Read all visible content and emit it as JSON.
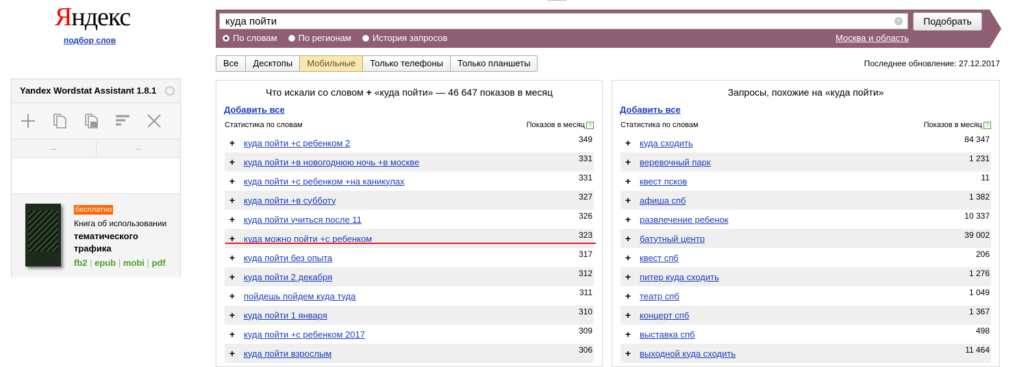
{
  "logo": {
    "text_first": "Я",
    "text_rest": "ндекс",
    "subtitle": "подбор слов"
  },
  "search": {
    "value": "куда пойти",
    "clear_glyph": "×",
    "button_label": "Подобрать",
    "radios": [
      {
        "label": "По словам",
        "selected": true
      },
      {
        "label": "По регионам",
        "selected": false
      },
      {
        "label": "История запросов",
        "selected": false
      }
    ],
    "region": "Москва и область",
    "band_color": "#8f5e73"
  },
  "tabs": [
    {
      "label": "Все",
      "active": false
    },
    {
      "label": "Десктопы",
      "active": false
    },
    {
      "label": "Мобильные",
      "active": true
    },
    {
      "label": "Только телефоны",
      "active": false
    },
    {
      "label": "Только планшеты",
      "active": false
    }
  ],
  "updated": "Последнее обновление: 27.12.2017",
  "widget": {
    "title": "Yandex Wordstat Assistant 1.8.1",
    "tools": [
      "plus-icon",
      "copy-icon",
      "copy-count-icon",
      "sort-icon",
      "close-icon"
    ],
    "col1": "...",
    "col2": "...",
    "ad": {
      "badge": "бесплатно",
      "line1": "Книга об использовании",
      "line2": "тематического трафика",
      "formats": [
        "fb2",
        "epub",
        "mobi",
        "pdf"
      ]
    }
  },
  "left": {
    "heading_prefix": "Что искали со словом",
    "heading_plus": "+",
    "heading_suffix": "«куда пойти» — 46 647 показов в месяц",
    "add_all": "Добавить все",
    "col_words": "Статистика по словам",
    "col_counts": "Показов в месяц",
    "help": "?",
    "rows": [
      {
        "phrase": "куда пойти +с ребенком 2",
        "count": "349"
      },
      {
        "phrase": "куда пойти +в новогоднюю ночь +в москве",
        "count": "331"
      },
      {
        "phrase": "куда пойти +с ребенком +на каникулах",
        "count": "331"
      },
      {
        "phrase": "куда пойти +в субботу",
        "count": "327"
      },
      {
        "phrase": "куда пойти учиться после 11",
        "count": "326"
      },
      {
        "phrase": "куда можно пойти +с ребенком",
        "count": "323"
      },
      {
        "phrase": "куда пойти без опыта",
        "count": "317"
      },
      {
        "phrase": "куда пойти 2 декабря",
        "count": "312"
      },
      {
        "phrase": "пойдешь пойдем куда туда",
        "count": "311"
      },
      {
        "phrase": "куда пойти 1 января",
        "count": "310"
      },
      {
        "phrase": "куда пойти +с ребенком 2017",
        "count": "309"
      },
      {
        "phrase": "куда пойти взрослым",
        "count": "306"
      }
    ]
  },
  "right": {
    "heading": "Запросы, похожие на «куда пойти»",
    "add_all": "Добавить все",
    "col_words": "Статистика по словам",
    "col_counts": "Показов в месяц",
    "help": "?",
    "rows": [
      {
        "phrase": "куда сходить",
        "count": "84 347"
      },
      {
        "phrase": "веревочный парк",
        "count": "1 231"
      },
      {
        "phrase": "квест псков",
        "count": "11"
      },
      {
        "phrase": "афиша спб",
        "count": "1 382"
      },
      {
        "phrase": "развлечение ребенок",
        "count": "10 337"
      },
      {
        "phrase": "батутный центр",
        "count": "39 002"
      },
      {
        "phrase": "квест спб",
        "count": "206"
      },
      {
        "phrase": "питер куда сходить",
        "count": "1 276"
      },
      {
        "phrase": "театр спб",
        "count": "1 049"
      },
      {
        "phrase": "концерт спб",
        "count": "1 367"
      },
      {
        "phrase": "выставка спб",
        "count": "498"
      },
      {
        "phrase": "выходной куда сходить",
        "count": "11 464"
      }
    ]
  },
  "row_plus": "+"
}
